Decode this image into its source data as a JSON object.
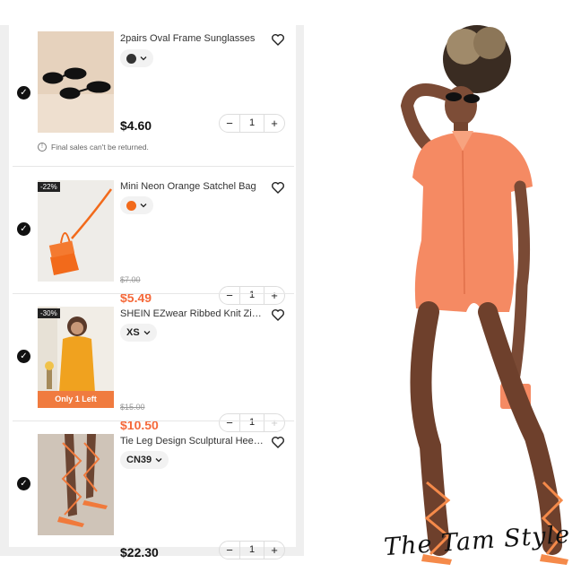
{
  "cart": {
    "items": [
      {
        "title": "2pairs Oval Frame Sunglasses",
        "variant": {
          "type": "color",
          "swatch": "#333333"
        },
        "price": "$4.60",
        "quantity": "1",
        "notice": "Final sales can't be returned."
      },
      {
        "title": "Mini Neon Orange Satchel Bag",
        "discount": "-22%",
        "variant": {
          "type": "color",
          "swatch": "#f26a1b"
        },
        "old_price": "$7.00",
        "price": "$5.49",
        "quantity": "1"
      },
      {
        "title": "SHEIN EZwear Ribbed Knit Zipp...",
        "discount": "-30%",
        "stock_label": "Only 1 Left",
        "variant": {
          "type": "size",
          "label": "XS"
        },
        "old_price": "$15.00",
        "price": "$10.50",
        "quantity": "1"
      },
      {
        "title": "Tie Leg Design Sculptural Heele...",
        "variant": {
          "type": "size",
          "label": "CN39"
        },
        "price": "$22.30",
        "quantity": "1"
      }
    ]
  },
  "photo": {
    "signature": "The Tam Style"
  },
  "colors": {
    "sale_price": "#f5693a",
    "outfit_orange": "#f58a63",
    "check": "#111111"
  },
  "icons": [
    "check-icon",
    "heart-icon",
    "chevron-down-icon",
    "info-icon",
    "minus-icon",
    "plus-icon"
  ]
}
